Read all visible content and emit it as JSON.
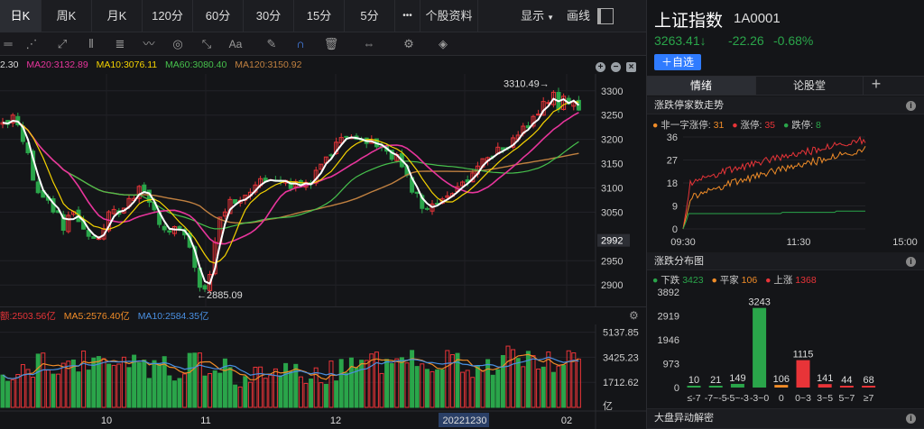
{
  "toolbar": {
    "periods": [
      "日K",
      "周K",
      "月K",
      "120分",
      "60分",
      "30分",
      "15分",
      "5分"
    ],
    "active_period": "日K",
    "more": "•••",
    "stock_info": "个股资料",
    "display": "显示",
    "display_arrow": "▼",
    "draw": "画线"
  },
  "chart_header": {
    "ma_lead": "2.30",
    "ma20": "MA20:3132.89",
    "ma10": "MA10:3076.11",
    "ma60": "MA60:3080.40",
    "ma120": "MA120:3150.92",
    "colors": {
      "ma5": "#ffffff",
      "ma10": "#f5d300",
      "ma20": "#e8359c",
      "ma60": "#46c04c",
      "ma120": "#c08040",
      "up": "#e83438",
      "down": "#2aa54a"
    }
  },
  "price_axis": {
    "labels": [
      "3300",
      "3250",
      "3200",
      "3150",
      "3100",
      "3050",
      "2992",
      "2950",
      "2900"
    ],
    "current": "2992",
    "high_label": "3310.49→",
    "low_label": "←2885.09"
  },
  "volume": {
    "legend_amount": "额:2503.56亿",
    "legend_ma5": "MA5:2576.40亿",
    "legend_ma10": "MA10:2584.35亿",
    "axis": [
      "5137.85",
      "3425.23",
      "1712.62",
      "亿"
    ],
    "date_labels": [
      "10",
      "11",
      "12",
      "20221230",
      "02"
    ]
  },
  "quote": {
    "name": "上证指数",
    "code": "1A0001",
    "price": "3263.41↓",
    "change": "-22.26",
    "pct": "-0.68%",
    "add_button": "＋自选"
  },
  "tabs": [
    "情绪",
    "论股堂"
  ],
  "tab_add": "+",
  "limit_section": {
    "title": "涨跌停家数走势",
    "legend": [
      {
        "label": "非一字涨停:",
        "value": "31",
        "color": "#f08c28"
      },
      {
        "label": "涨停:",
        "value": "35",
        "color": "#e83438"
      },
      {
        "label": "跌停:",
        "value": "8",
        "color": "#2aa54a"
      }
    ],
    "y_labels": [
      "36",
      "27",
      "18",
      "9",
      "0"
    ],
    "x_labels": [
      "09:30",
      "11:30",
      "15:00"
    ]
  },
  "dist_section": {
    "title": "涨跌分布图",
    "legend": [
      {
        "label": "下跌",
        "value": "3423",
        "color": "#2aa54a"
      },
      {
        "label": "平家",
        "value": "106",
        "color": "#f08c28"
      },
      {
        "label": "上涨",
        "value": "1368",
        "color": "#e83438"
      }
    ],
    "y_labels": [
      "3892",
      "2919",
      "1946",
      "973",
      "0"
    ],
    "bars": [
      {
        "cat": "≤-7",
        "value": 10,
        "color": "#2aa54a"
      },
      {
        "cat": "-7~-5",
        "value": 21,
        "color": "#2aa54a"
      },
      {
        "cat": "-5~-3",
        "value": 149,
        "color": "#2aa54a"
      },
      {
        "cat": "-3~0",
        "value": 3243,
        "color": "#2aa54a"
      },
      {
        "cat": "0",
        "value": 106,
        "color": "#f08c28"
      },
      {
        "cat": "0~3",
        "value": 1115,
        "color": "#e83438"
      },
      {
        "cat": "3~5",
        "value": 141,
        "color": "#e83438"
      },
      {
        "cat": "5~7",
        "value": 44,
        "color": "#e83438"
      },
      {
        "cat": "≥7",
        "value": 68,
        "color": "#e83438"
      }
    ]
  },
  "abnormal_section": {
    "title": "大盘异动解密"
  }
}
